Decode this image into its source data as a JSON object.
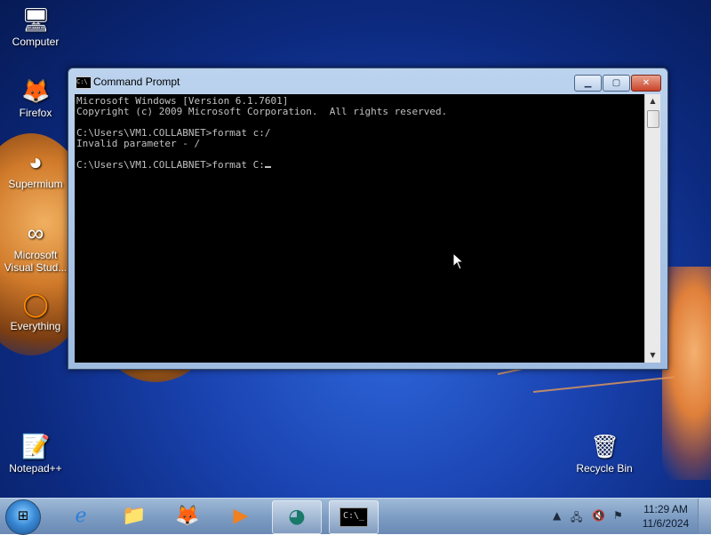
{
  "desktop": {
    "icons": [
      {
        "label": "Computer",
        "icon": "computer-icon"
      },
      {
        "label": "Firefox",
        "icon": "firefox-icon"
      },
      {
        "label": "Supermium",
        "icon": "supermium-icon"
      },
      {
        "label": "Microsoft Visual Stud...",
        "icon": "visual-studio-icon"
      },
      {
        "label": "Everything",
        "icon": "everything-icon"
      },
      {
        "label": "Notepad++",
        "icon": "notepadpp-icon"
      },
      {
        "label": "Recycle Bin",
        "icon": "recycle-bin-icon"
      }
    ]
  },
  "window": {
    "title": "Command Prompt",
    "console_lines": [
      "Microsoft Windows [Version 6.1.7601]",
      "Copyright (c) 2009 Microsoft Corporation.  All rights reserved.",
      "",
      "C:\\Users\\VM1.COLLABNET>format c:/",
      "Invalid parameter - /",
      "",
      "C:\\Users\\VM1.COLLABNET>format C:"
    ]
  },
  "taskbar": {
    "buttons": [
      {
        "name": "internet-explorer",
        "icon": "ie-icon"
      },
      {
        "name": "windows-explorer",
        "icon": "folder-icon"
      },
      {
        "name": "firefox",
        "icon": "firefox-icon"
      },
      {
        "name": "media-player",
        "icon": "media-icon"
      },
      {
        "name": "supermium",
        "icon": "supermium-icon"
      },
      {
        "name": "command-prompt",
        "icon": "cmd-icon",
        "active": true
      }
    ],
    "clock": {
      "time": "11:29 AM",
      "date": "11/6/2024"
    }
  },
  "colors": {
    "console_bg": "#000000",
    "console_text": "#c0c0c0",
    "taskbar": "#7f9ec4"
  }
}
